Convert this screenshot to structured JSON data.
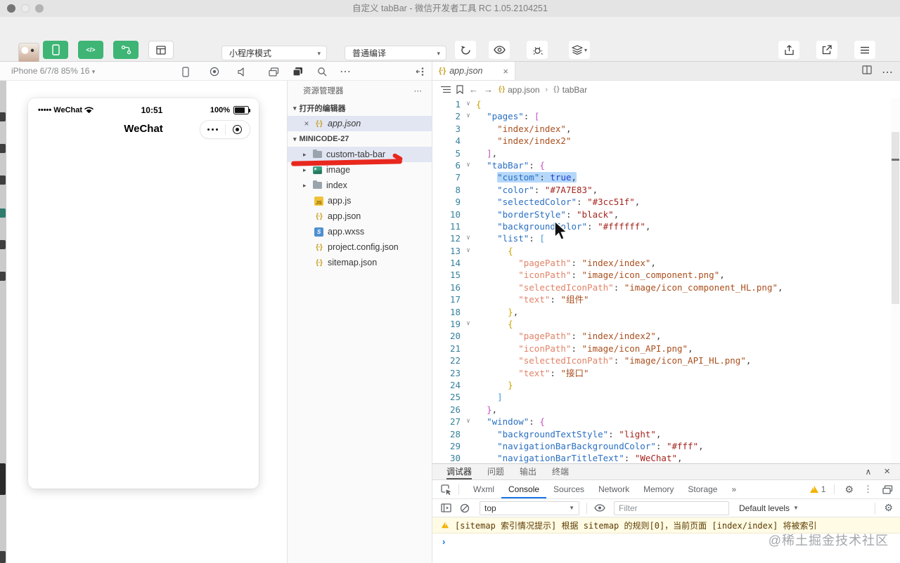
{
  "theme": {
    "accent_green": "#3eb575",
    "console_blue": "#1a73e8",
    "warning_bg": "#fffbe5",
    "annotation_red": "#e8281e",
    "selection": "#b5d8fa",
    "highlight_row": "#e2e6f3"
  },
  "titlebar": {
    "title": "自定义 tabBar - 微信开发者工具 RC 1.05.2104251"
  },
  "toolbar": {
    "modes": [
      {
        "label": "模拟器",
        "icon": "simulator",
        "active": true
      },
      {
        "label": "编辑器",
        "icon": "editor",
        "active": true
      },
      {
        "label": "调试器",
        "icon": "debugger",
        "active": true
      },
      {
        "label": "可视化",
        "icon": "visual",
        "active": false
      }
    ],
    "mode_dropdown": "小程序模式",
    "compile_dropdown": "普通编译",
    "actions": [
      {
        "label": "编译",
        "icon": "compile"
      },
      {
        "label": "预览",
        "icon": "preview"
      },
      {
        "label": "真机调试",
        "icon": "remote-debug"
      },
      {
        "label": "清缓存",
        "icon": "clear-cache",
        "caret": true
      }
    ],
    "right_actions": [
      {
        "label": "分享",
        "icon": "share"
      },
      {
        "label": "测试号",
        "icon": "test-account"
      },
      {
        "label": "详情",
        "icon": "details"
      }
    ]
  },
  "simulator": {
    "device": "iPhone 6/7/8 85% 16",
    "phone": {
      "carrier": "••••• WeChat",
      "time": "10:51",
      "battery": "100%",
      "nav_title": "WeChat"
    }
  },
  "explorer": {
    "title": "资源管理器",
    "sections": [
      {
        "label": "打开的编辑器",
        "items": [
          {
            "name": "app.json",
            "icon": "json",
            "close": true,
            "italic": true,
            "selected": true
          }
        ]
      },
      {
        "label": "MINICODE-27",
        "items": [
          {
            "name": "custom-tab-bar",
            "icon": "folder",
            "arrow": true,
            "selected": true
          },
          {
            "name": "image",
            "icon": "image",
            "arrow": true
          },
          {
            "name": "index",
            "icon": "folder",
            "arrow": true
          },
          {
            "name": "app.js",
            "icon": "js"
          },
          {
            "name": "app.json",
            "icon": "json"
          },
          {
            "name": "app.wxss",
            "icon": "wxss"
          },
          {
            "name": "project.config.json",
            "icon": "json"
          },
          {
            "name": "sitemap.json",
            "icon": "json"
          }
        ]
      }
    ]
  },
  "editor": {
    "tab": {
      "name": "app.json"
    },
    "breadcrumb": [
      "app.json",
      "tabBar"
    ],
    "code": [
      {
        "n": 1,
        "fold": true,
        "tokens": [
          [
            "b0",
            "{"
          ]
        ]
      },
      {
        "n": 2,
        "fold": true,
        "tokens": [
          [
            "ws",
            "  "
          ],
          [
            "k1",
            "\"pages\""
          ],
          [
            "pu",
            ": "
          ],
          [
            "b1",
            "["
          ]
        ]
      },
      {
        "n": 3,
        "tokens": [
          [
            "ws",
            "    "
          ],
          [
            "s2",
            "\"index/index\""
          ],
          [
            "pu",
            ","
          ]
        ]
      },
      {
        "n": 4,
        "tokens": [
          [
            "ws",
            "    "
          ],
          [
            "s2",
            "\"index/index2\""
          ]
        ]
      },
      {
        "n": 5,
        "tokens": [
          [
            "ws",
            "  "
          ],
          [
            "b1",
            "]"
          ],
          [
            "pu",
            ","
          ]
        ]
      },
      {
        "n": 6,
        "fold": true,
        "tokens": [
          [
            "ws",
            "  "
          ],
          [
            "k1",
            "\"tabBar\""
          ],
          [
            "pu",
            ": "
          ],
          [
            "b1",
            "{"
          ]
        ]
      },
      {
        "n": 7,
        "sel": true,
        "tokens": [
          [
            "ws",
            "    "
          ],
          [
            "k1",
            "\"custom\""
          ],
          [
            "pu",
            ": "
          ],
          [
            "kw",
            "true"
          ],
          [
            "pu",
            ","
          ]
        ]
      },
      {
        "n": 8,
        "tokens": [
          [
            "ws",
            "    "
          ],
          [
            "k1",
            "\"color\""
          ],
          [
            "pu",
            ": "
          ],
          [
            "s1",
            "\"#7A7E83\""
          ],
          [
            "pu",
            ","
          ]
        ]
      },
      {
        "n": 9,
        "tokens": [
          [
            "ws",
            "    "
          ],
          [
            "k1",
            "\"selectedColor\""
          ],
          [
            "pu",
            ": "
          ],
          [
            "s1",
            "\"#3cc51f\""
          ],
          [
            "pu",
            ","
          ]
        ]
      },
      {
        "n": 10,
        "tokens": [
          [
            "ws",
            "    "
          ],
          [
            "k1",
            "\"borderStyle\""
          ],
          [
            "pu",
            ": "
          ],
          [
            "s1",
            "\"black\""
          ],
          [
            "pu",
            ","
          ]
        ]
      },
      {
        "n": 11,
        "tokens": [
          [
            "ws",
            "    "
          ],
          [
            "k1",
            "\"backgroundColor\""
          ],
          [
            "pu",
            ": "
          ],
          [
            "s1",
            "\"#ffffff\""
          ],
          [
            "pu",
            ","
          ]
        ]
      },
      {
        "n": 12,
        "fold": true,
        "tokens": [
          [
            "ws",
            "    "
          ],
          [
            "k1",
            "\"list\""
          ],
          [
            "pu",
            ": "
          ],
          [
            "b2",
            "["
          ]
        ]
      },
      {
        "n": 13,
        "fold": true,
        "tokens": [
          [
            "ws",
            "      "
          ],
          [
            "b0",
            "{"
          ]
        ]
      },
      {
        "n": 14,
        "tokens": [
          [
            "ws",
            "        "
          ],
          [
            "k2",
            "\"pagePath\""
          ],
          [
            "pu",
            ": "
          ],
          [
            "s2",
            "\"index/index\""
          ],
          [
            "pu",
            ","
          ]
        ]
      },
      {
        "n": 15,
        "tokens": [
          [
            "ws",
            "        "
          ],
          [
            "k2",
            "\"iconPath\""
          ],
          [
            "pu",
            ": "
          ],
          [
            "s2",
            "\"image/icon_component.png\""
          ],
          [
            "pu",
            ","
          ]
        ]
      },
      {
        "n": 16,
        "tokens": [
          [
            "ws",
            "        "
          ],
          [
            "k2",
            "\"selectedIconPath\""
          ],
          [
            "pu",
            ": "
          ],
          [
            "s2",
            "\"image/icon_component_HL.png\""
          ],
          [
            "pu",
            ","
          ]
        ]
      },
      {
        "n": 17,
        "tokens": [
          [
            "ws",
            "        "
          ],
          [
            "k2",
            "\"text\""
          ],
          [
            "pu",
            ": "
          ],
          [
            "s2",
            "\"组件\""
          ]
        ]
      },
      {
        "n": 18,
        "tokens": [
          [
            "ws",
            "      "
          ],
          [
            "b0",
            "}"
          ],
          [
            "pu",
            ","
          ]
        ]
      },
      {
        "n": 19,
        "fold": true,
        "tokens": [
          [
            "ws",
            "      "
          ],
          [
            "b0",
            "{"
          ]
        ]
      },
      {
        "n": 20,
        "tokens": [
          [
            "ws",
            "        "
          ],
          [
            "k2",
            "\"pagePath\""
          ],
          [
            "pu",
            ": "
          ],
          [
            "s2",
            "\"index/index2\""
          ],
          [
            "pu",
            ","
          ]
        ]
      },
      {
        "n": 21,
        "tokens": [
          [
            "ws",
            "        "
          ],
          [
            "k2",
            "\"iconPath\""
          ],
          [
            "pu",
            ": "
          ],
          [
            "s2",
            "\"image/icon_API.png\""
          ],
          [
            "pu",
            ","
          ]
        ]
      },
      {
        "n": 22,
        "tokens": [
          [
            "ws",
            "        "
          ],
          [
            "k2",
            "\"selectedIconPath\""
          ],
          [
            "pu",
            ": "
          ],
          [
            "s2",
            "\"image/icon_API_HL.png\""
          ],
          [
            "pu",
            ","
          ]
        ]
      },
      {
        "n": 23,
        "tokens": [
          [
            "ws",
            "        "
          ],
          [
            "k2",
            "\"text\""
          ],
          [
            "pu",
            ": "
          ],
          [
            "s2",
            "\"接口\""
          ]
        ]
      },
      {
        "n": 24,
        "tokens": [
          [
            "ws",
            "      "
          ],
          [
            "b0",
            "}"
          ]
        ]
      },
      {
        "n": 25,
        "tokens": [
          [
            "ws",
            "    "
          ],
          [
            "b2",
            "]"
          ]
        ]
      },
      {
        "n": 26,
        "tokens": [
          [
            "ws",
            "  "
          ],
          [
            "b1",
            "}"
          ],
          [
            "pu",
            ","
          ]
        ]
      },
      {
        "n": 27,
        "fold": true,
        "tokens": [
          [
            "ws",
            "  "
          ],
          [
            "k1",
            "\"window\""
          ],
          [
            "pu",
            ": "
          ],
          [
            "b1",
            "{"
          ]
        ]
      },
      {
        "n": 28,
        "tokens": [
          [
            "ws",
            "    "
          ],
          [
            "k1",
            "\"backgroundTextStyle\""
          ],
          [
            "pu",
            ": "
          ],
          [
            "s1",
            "\"light\""
          ],
          [
            "pu",
            ","
          ]
        ]
      },
      {
        "n": 29,
        "tokens": [
          [
            "ws",
            "    "
          ],
          [
            "k1",
            "\"navigationBarBackgroundColor\""
          ],
          [
            "pu",
            ": "
          ],
          [
            "s1",
            "\"#fff\""
          ],
          [
            "pu",
            ","
          ]
        ]
      },
      {
        "n": 30,
        "tokens": [
          [
            "ws",
            "    "
          ],
          [
            "k1",
            "\"navigationBarTitleText\""
          ],
          [
            "pu",
            ": "
          ],
          [
            "s1",
            "\"WeChat\""
          ],
          [
            "pu",
            ","
          ]
        ]
      }
    ]
  },
  "debugger": {
    "panel_tabs": [
      {
        "label": "调试器",
        "active": true
      },
      {
        "label": "问题"
      },
      {
        "label": "输出"
      },
      {
        "label": "终端"
      }
    ],
    "devtools_tabs": [
      {
        "label": "Wxml"
      },
      {
        "label": "Console",
        "active": true
      },
      {
        "label": "Sources"
      },
      {
        "label": "Network"
      },
      {
        "label": "Memory"
      },
      {
        "label": "Storage"
      },
      {
        "label": "»"
      }
    ],
    "warning_count": "1",
    "console": {
      "context": "top",
      "filter_placeholder": "Filter",
      "levels": "Default levels",
      "warning": "[sitemap 索引情况提示] 根据 sitemap 的规则[0]，当前页面 [index/index] 将被索引"
    }
  },
  "watermark": "@稀土掘金技术社区"
}
